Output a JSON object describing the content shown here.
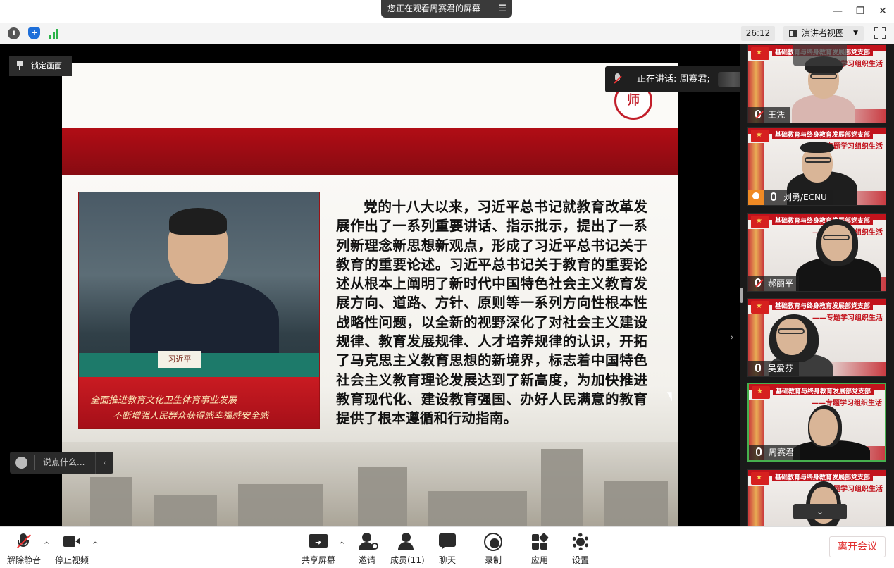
{
  "window": {
    "share_notice": "您正在观看周赛君的屏幕",
    "menu_glyph": "☰"
  },
  "toolbar": {
    "timer": "26:12",
    "view_mode": "演讲者视图",
    "info_icon": "info-icon",
    "shield_icon": "shield-icon",
    "signal_icon": "signal-icon"
  },
  "stage": {
    "lock_label": "锁定画面",
    "speaking_label": "正在讲话: 周赛君;",
    "chat_placeholder": "说点什么...",
    "chat_chevron": "‹",
    "collapse_glyph": "›"
  },
  "slide": {
    "seal_text": "师",
    "nameplate": "习近平",
    "caption_line1": "全面推进教育文化卫生体育事业发展",
    "caption_line2": "不断增强人民群众获得感幸福感安全感",
    "body_text": "党的十八大以来，习近平总书记就教育改革发展作出了一系列重要讲话、指示批示，提出了一系列新理念新思想新观点，形成了习近平总书记关于教育的重要论述。习近平总书记关于教育的重要论述从根本上阐明了新时代中国特色社会主义教育发展方向、道路、方针、原则等一系列方向性根本性战略性问题，以全新的视野深化了对社会主义建设规律、教育发展规律、人才培养规律的认识，开拓了马克思主义教育思想的新境界，标志着中国特色社会主义教育理论发展达到了新高度，为加快推进教育现代化、建设教育强国、办好人民满意的教育提供了根本遵循和行动指南。"
  },
  "participants": {
    "banner": "基础教育与终身教育发展部党支部",
    "subtitle": "——专题学习组织生活",
    "tiles": [
      {
        "name": "王凭",
        "muted": true
      },
      {
        "name": "刘勇/ECNU",
        "muted": false,
        "host": true
      },
      {
        "name": "郝丽平",
        "muted": true
      },
      {
        "name": "吴爱芬",
        "muted": false
      },
      {
        "name": "周赛君",
        "muted": false,
        "active": true
      },
      {
        "name": "",
        "muted": false
      }
    ],
    "scroll_down": "⌄"
  },
  "controls": {
    "unmute": "解除静音",
    "stop_video": "停止视频",
    "share_screen": "共享屏幕",
    "invite": "邀请",
    "members": "成员(11)",
    "chat": "聊天",
    "record": "录制",
    "apps": "应用",
    "settings": "设置",
    "leave": "离开会议",
    "caret": "^"
  },
  "colors": {
    "accent_red": "#e12d2d",
    "active_border": "#46b04e",
    "banner_red": "#c2131c"
  }
}
